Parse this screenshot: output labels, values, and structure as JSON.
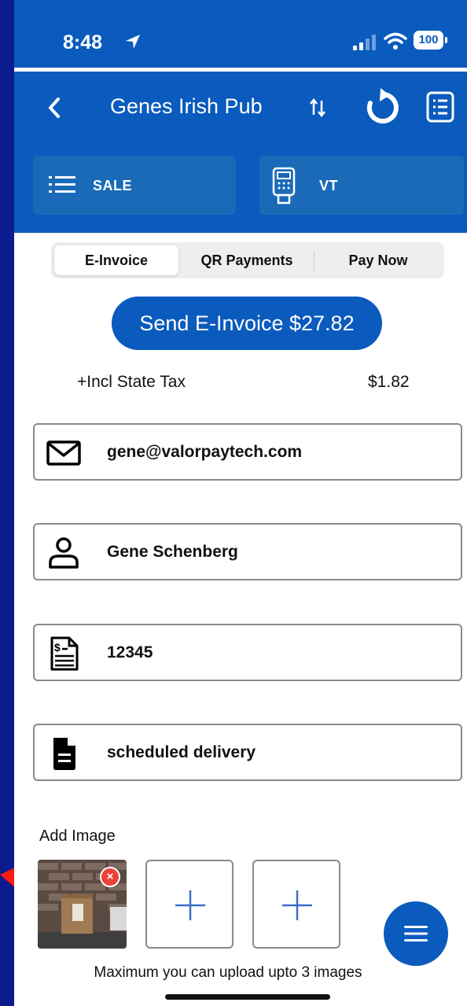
{
  "status_bar": {
    "time": "8:48",
    "battery": "100"
  },
  "nav": {
    "title": "Genes Irish Pub"
  },
  "modes": {
    "sale_label": "SALE",
    "vt_label": "VT"
  },
  "tabs": [
    {
      "label": "E-Invoice",
      "active": true
    },
    {
      "label": "QR Payments",
      "active": false
    },
    {
      "label": "Pay Now",
      "active": false
    }
  ],
  "send_button": {
    "label": "Send E-Invoice $27.82"
  },
  "tax": {
    "label": "+Incl State Tax",
    "value": "$1.82"
  },
  "fields": {
    "email": "gene@valorpaytech.com",
    "name": "Gene Schenberg",
    "invoice_number": "12345",
    "note": "scheduled delivery"
  },
  "images": {
    "label": "Add Image",
    "max_note": "Maximum you can upload upto 3 images",
    "remove_glyph": "×"
  },
  "colors": {
    "primary": "#0a5bbd",
    "mode_button": "#1a6ab8",
    "remove_badge": "#e8433b"
  }
}
